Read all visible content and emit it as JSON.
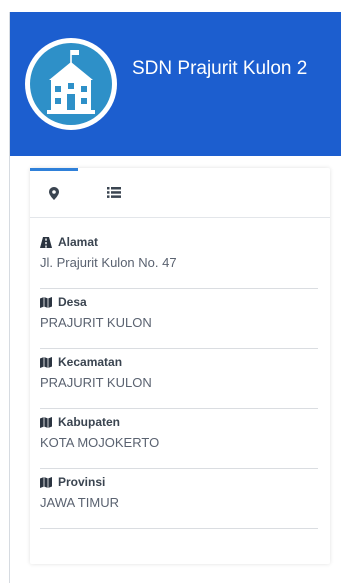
{
  "header": {
    "title": "SDN Prajurit Kulon 2",
    "background": "#1c5ecf",
    "logo_icon": "school-building-icon"
  },
  "tabs": [
    {
      "icon": "map-marker-icon",
      "active": true
    },
    {
      "icon": "list-icon",
      "active": false
    }
  ],
  "info": [
    {
      "icon": "road-icon",
      "label": "Alamat",
      "value": "Jl. Prajurit Kulon No. 47"
    },
    {
      "icon": "map-icon",
      "label": "Desa",
      "value": "PRAJURIT KULON"
    },
    {
      "icon": "map-icon",
      "label": "Kecamatan",
      "value": "PRAJURIT KULON"
    },
    {
      "icon": "map-icon",
      "label": "Kabupaten",
      "value": "KOTA MOJOKERTO"
    },
    {
      "icon": "map-icon",
      "label": "Provinsi",
      "value": "JAWA TIMUR"
    }
  ]
}
